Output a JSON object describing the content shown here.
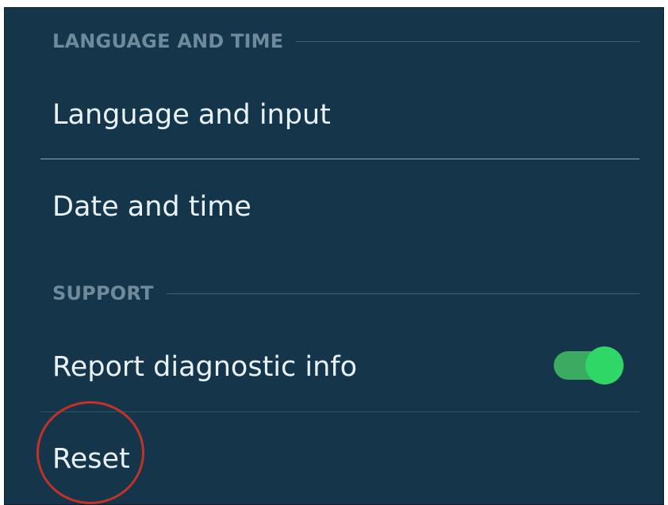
{
  "sections": {
    "language_time": {
      "header": "LANGUAGE AND TIME",
      "items": [
        "Language and input",
        "Date and time"
      ]
    },
    "support": {
      "header": "SUPPORT",
      "items": [
        "Report diagnostic info",
        "Reset"
      ]
    }
  },
  "toggle": {
    "state": "on",
    "track_color": "#3bab62",
    "knob_color": "#2fd866"
  },
  "annotation": {
    "color": "#c23226",
    "target": "Reset"
  }
}
